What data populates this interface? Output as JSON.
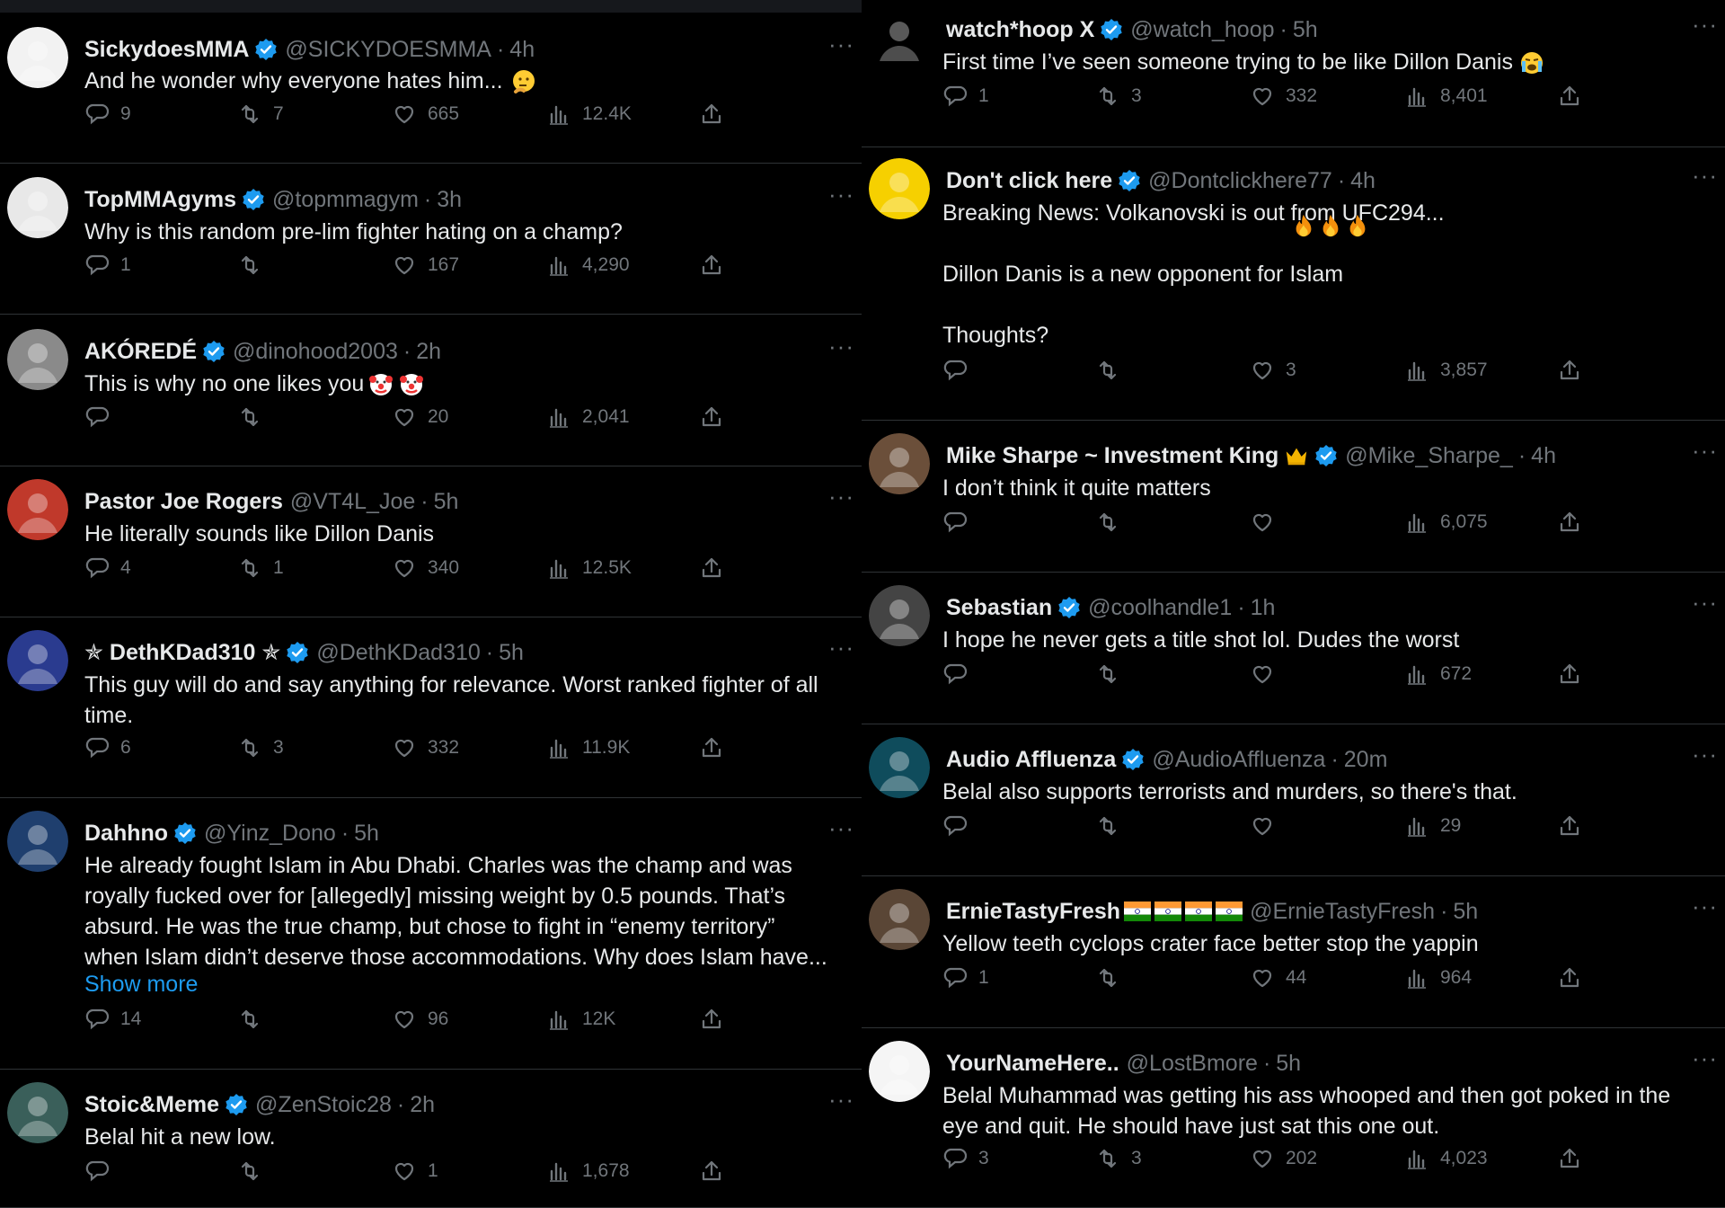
{
  "colors": {
    "background": "#000000",
    "text": "#e7e9ea",
    "muted": "#71767b",
    "accent": "#1d9bf0",
    "border": "#2f3336"
  },
  "left": [
    {
      "name": "SickydoesMMA",
      "verified": true,
      "handle": "@SICKYDOESMMA",
      "time": "4h",
      "text": "And he wonder why everyone hates him...",
      "emoji": "thinking-face",
      "replies": "9",
      "reposts": "7",
      "likes": "665",
      "views": "12.4K"
    },
    {
      "name": "TopMMAgyms",
      "verified": true,
      "handle": "@topmmagym",
      "time": "3h",
      "text": "Why is this random pre-lim fighter hating on a champ?",
      "replies": "1",
      "reposts": "",
      "likes": "167",
      "views": "4,290"
    },
    {
      "name": "AKÓREDÉ",
      "verified": true,
      "handle": "@dinohood2003",
      "time": "2h",
      "text": "This is why no one likes you",
      "emoji": "clown-face x2",
      "replies": "",
      "reposts": "",
      "likes": "20",
      "views": "2,041"
    },
    {
      "name": "Pastor Joe Rogers",
      "verified": false,
      "handle": "@VT4L_Joe",
      "time": "5h",
      "text": "He literally sounds like Dillon Danis",
      "replies": "4",
      "reposts": "1",
      "likes": "340",
      "views": "12.5K"
    },
    {
      "name": "✯ DethKDad310 ✯",
      "verified": true,
      "handle": "@DethKDad310",
      "time": "5h",
      "text": "This guy will do and say anything for relevance. Worst ranked fighter of all\ntime.",
      "replies": "6",
      "reposts": "3",
      "likes": "332",
      "views": "11.9K"
    },
    {
      "name": "Dahhno",
      "verified": true,
      "handle": "@Yinz_Dono",
      "time": "5h",
      "text": "He already fought Islam in Abu Dhabi. Charles was the champ and was\nroyally fucked over for [allegedly] missing weight by 0.5 pounds. That’s\nabsurd. He was the true champ, but chose to fight in “enemy territory”\nwhen Islam didn’t deserve those accommodations. Why does Islam have...",
      "show_more": "Show more",
      "replies": "14",
      "reposts": "",
      "likes": "96",
      "views": "12K"
    },
    {
      "name": "Stoic&Meme",
      "verified": true,
      "handle": "@ZenStoic28",
      "time": "2h",
      "text": "Belal hit a new low.",
      "replies": "",
      "reposts": "",
      "likes": "1",
      "views": "1,678"
    }
  ],
  "right": [
    {
      "name": "watch*hoop X",
      "verified": true,
      "handle": "@watch_hoop",
      "time": "5h",
      "text": "First time I’ve seen someone trying to be like Dillon Danis",
      "emoji": "loudly-crying-face",
      "replies": "1",
      "reposts": "3",
      "likes": "332",
      "views": "8,401"
    },
    {
      "name": "Don't click here",
      "verified": true,
      "handle": "@Dontclickhere77",
      "time": "4h",
      "text": "Breaking News: Volkanovski is out from UFC294...\n\nDillon Danis is a new opponent for Islam\n\nThoughts?",
      "emoji": "fire x3",
      "replies": "",
      "reposts": "",
      "likes": "3",
      "views": "3,857"
    },
    {
      "name": "Mike Sharpe ~ Investment King",
      "verified": true,
      "handle": "@Mike_Sharpe_",
      "time": "4h",
      "text": "I don’t think it quite matters",
      "emoji": "crown",
      "replies": "",
      "reposts": "",
      "likes": "",
      "views": "6,075"
    },
    {
      "name": "Sebastian",
      "verified": true,
      "handle": "@coolhandle1",
      "time": "1h",
      "text": "I hope he never gets a title shot lol. Dudes the worst",
      "replies": "",
      "reposts": "",
      "likes": "",
      "views": "672"
    },
    {
      "name": "Audio Affluenza",
      "verified": true,
      "handle": "@AudioAffluenza",
      "time": "20m",
      "text": "Belal also supports terrorists and murders, so there's that.",
      "replies": "",
      "reposts": "",
      "likes": "",
      "views": "29"
    },
    {
      "name": "ErnieTastyFresh",
      "verified": false,
      "handle": "@ErnieTastyFresh",
      "time": "5h",
      "text": "Yellow teeth cyclops crater face better stop the yappin",
      "emoji": "india-flag x4",
      "replies": "1",
      "reposts": "",
      "likes": "44",
      "views": "964"
    },
    {
      "name": "YourNameHere..",
      "verified": false,
      "handle": "@LostBmore",
      "time": "5h",
      "text": "Belal Muhammad was getting his ass whooped and then got poked in the\neye and quit. He should have just sat this one out.",
      "replies": "3",
      "reposts": "3",
      "likes": "202",
      "views": "4,023"
    }
  ]
}
